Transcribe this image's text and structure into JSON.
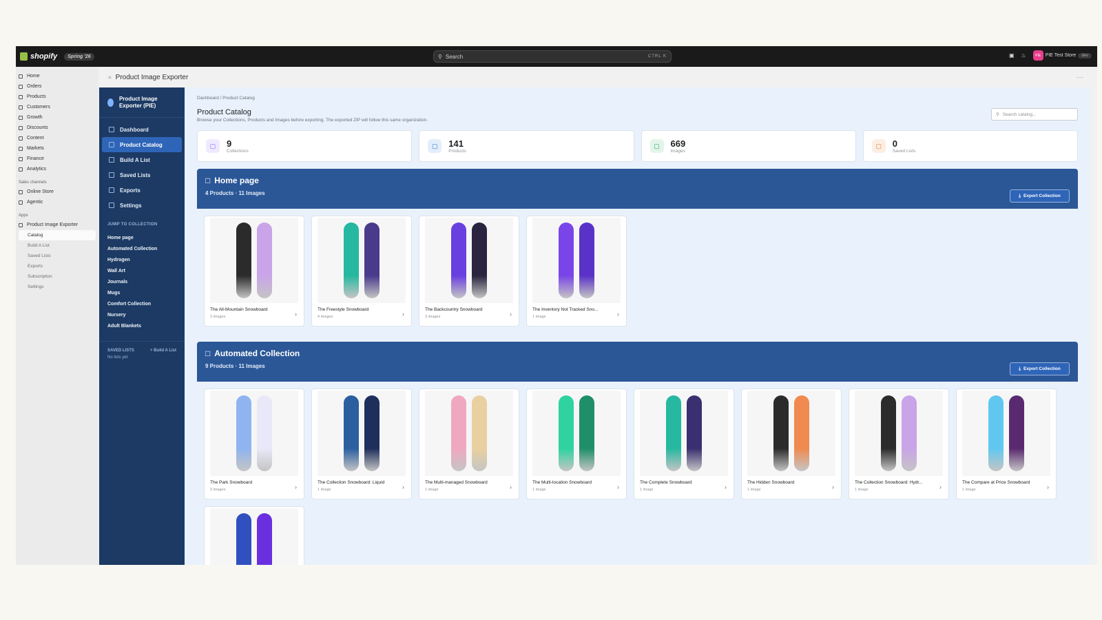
{
  "topbar": {
    "brand": "shopify",
    "edition": "Spring '26",
    "search_label": "Search",
    "search_kbd": "CTRL K",
    "store_initials": "PIE",
    "store_name": "PIE Test Store",
    "store_badge": "dev"
  },
  "admin_nav": {
    "items": [
      {
        "label": "Home",
        "icon": "home-icon"
      },
      {
        "label": "Orders",
        "icon": "orders-icon"
      },
      {
        "label": "Products",
        "icon": "tag-icon"
      },
      {
        "label": "Customers",
        "icon": "person-icon"
      },
      {
        "label": "Growth",
        "icon": "growth-icon"
      },
      {
        "label": "Discounts",
        "icon": "discount-icon"
      },
      {
        "label": "Content",
        "icon": "content-icon"
      },
      {
        "label": "Markets",
        "icon": "globe-icon"
      },
      {
        "label": "Finance",
        "icon": "bank-icon"
      },
      {
        "label": "Analytics",
        "icon": "chart-icon"
      }
    ],
    "sales_channels_label": "Sales channels",
    "channels": [
      {
        "label": "Online Store",
        "icon": "store-icon"
      },
      {
        "label": "Agentic",
        "icon": "agent-icon"
      }
    ],
    "apps_label": "Apps",
    "app_name": "Product Image Exporter",
    "app_sub": [
      "Catalog",
      "Build A List",
      "Saved Lists",
      "Exports",
      "Subscription",
      "Settings"
    ]
  },
  "app_header": {
    "title": "Product Image Exporter",
    "more": "···"
  },
  "app_nav": {
    "brand": "Product Image Exporter (PIE)",
    "items": [
      {
        "label": "Dashboard",
        "icon": "grid-icon"
      },
      {
        "label": "Product Catalog",
        "icon": "folder-icon"
      },
      {
        "label": "Build A List",
        "icon": "list-icon"
      },
      {
        "label": "Saved Lists",
        "icon": "stack-icon"
      },
      {
        "label": "Exports",
        "icon": "download-icon"
      },
      {
        "label": "Settings",
        "icon": "gear-icon"
      }
    ],
    "jump_heading": "JUMP TO COLLECTION",
    "jump_items": [
      "Home page",
      "Automated Collection",
      "Hydrogen",
      "Wall Art",
      "Journals",
      "Mugs",
      "Comfort Collection",
      "Nursery",
      "Adult Blankets"
    ],
    "saved_heading": "SAVED LISTS",
    "saved_action": "+ Build A List",
    "saved_empty": "No lists yet"
  },
  "main": {
    "breadcrumb": "Dashboard / Product Catalog",
    "title": "Product Catalog",
    "subtitle": "Browse your Collections, Products and Images before exporting. The exported ZIP will follow this same organization.",
    "search_placeholder": "Search catalog...",
    "stats": [
      {
        "value": "9",
        "label": "Collections",
        "icon": "folder-icon",
        "color": "#7b61ff",
        "bg": "#efeaff"
      },
      {
        "value": "141",
        "label": "Products",
        "icon": "box-icon",
        "color": "#2c6ecb",
        "bg": "#e3eefc"
      },
      {
        "value": "669",
        "label": "Images",
        "icon": "image-icon",
        "color": "#2e9e5b",
        "bg": "#e3f5ea"
      },
      {
        "value": "0",
        "label": "Saved Lists",
        "icon": "bookmark-icon",
        "color": "#e07b39",
        "bg": "#fdeee2"
      }
    ],
    "collections": [
      {
        "title": "Home page",
        "meta": "4 Products · 11 Images",
        "export_label": "Export Collection",
        "products": [
          {
            "name": "The All-Mountain Snowboard",
            "count": "3 images",
            "colors": [
              "#2b2b2b",
              "#c9a4e8"
            ]
          },
          {
            "name": "The Freestyle Snowboard",
            "count": "4 images",
            "colors": [
              "#26b8a0",
              "#4a3a8c"
            ]
          },
          {
            "name": "The Backcountry Snowboard",
            "count": "3 images",
            "colors": [
              "#6a3fe0",
              "#2a2440"
            ]
          },
          {
            "name": "The Inventory Not Tracked Sno...",
            "count": "1 image",
            "colors": [
              "#7a45e8",
              "#5a32c8"
            ]
          }
        ]
      },
      {
        "title": "Automated Collection",
        "meta": "9 Products · 11 Images",
        "export_label": "Export Collection",
        "products": [
          {
            "name": "The Park Snowboard",
            "count": "3 images",
            "colors": [
              "#8fb4f0",
              "#e8e8f8"
            ]
          },
          {
            "name": "The Collection Snowboard: Liquid",
            "count": "1 image",
            "colors": [
              "#2b5fa0",
              "#1f2f5c"
            ]
          },
          {
            "name": "The Multi-managed Snowboard",
            "count": "1 image",
            "colors": [
              "#f0a8c0",
              "#e8d0a0"
            ]
          },
          {
            "name": "The Multi-location Snowboard",
            "count": "1 image",
            "colors": [
              "#2ed3a0",
              "#1f8f6a"
            ]
          },
          {
            "name": "The Complete Snowboard",
            "count": "1 image",
            "colors": [
              "#26b8a0",
              "#3a2f70"
            ]
          },
          {
            "name": "The Hidden Snowboard",
            "count": "1 image",
            "colors": [
              "#2b2b2b",
              "#f08a50"
            ]
          },
          {
            "name": "The Collection Snowboard: Hydr...",
            "count": "1 image",
            "colors": [
              "#2b2b2b",
              "#c9a4e8"
            ]
          },
          {
            "name": "The Compare at Price Snowboard",
            "count": "1 image",
            "colors": [
              "#60c8f0",
              "#5a2a70"
            ]
          },
          {
            "name": "",
            "count": "",
            "colors": [
              "#3050c0",
              "#6a30e0"
            ]
          }
        ]
      }
    ]
  }
}
